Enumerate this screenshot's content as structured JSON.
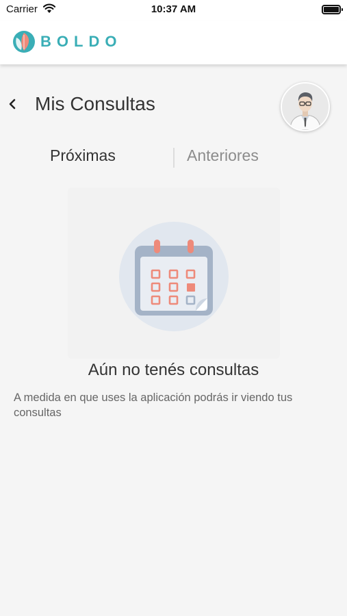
{
  "status_bar": {
    "carrier": "Carrier",
    "time": "10:37 AM"
  },
  "header": {
    "brand_name": "BOLDO",
    "brand_color": "#3aaeb6",
    "accent_color": "#ee8a7a"
  },
  "page": {
    "title": "Mis Consultas",
    "back_icon": "chevron-left-icon",
    "avatar_icon": "doctor-avatar"
  },
  "tabs": [
    {
      "label": "Próximas",
      "selected": true
    },
    {
      "label": "Anteriores",
      "selected": false
    }
  ],
  "empty_state": {
    "icon": "calendar-icon",
    "title": "Aún no tenés consultas",
    "subtitle": "A medida en que uses la aplicación podrás ir viendo tus consultas"
  }
}
